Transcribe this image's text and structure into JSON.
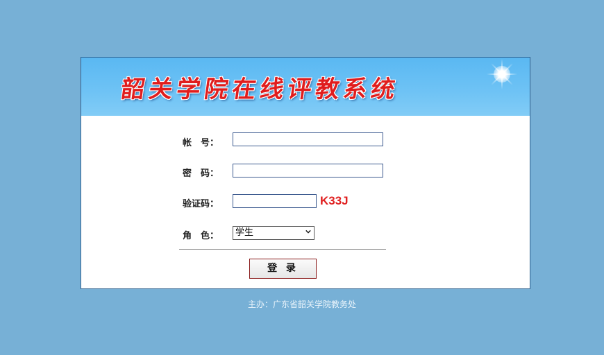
{
  "banner": {
    "title": "韶关学院在线评教系统"
  },
  "form": {
    "account_label": "帐　号：",
    "account_value": "",
    "password_label": "密　码：",
    "password_value": "",
    "captcha_label": "验证码：",
    "captcha_value": "",
    "captcha_code": "K33J",
    "role_label": "角　色：",
    "role_selected": "学生",
    "login_button": "登 录"
  },
  "footer": {
    "text": "主办：广东省韶关学院教务处"
  },
  "colors": {
    "page_background": "#77b0d6",
    "title_red": "#e01d1d",
    "captcha_red": "#e02020",
    "input_border": "#3c5a8f"
  }
}
